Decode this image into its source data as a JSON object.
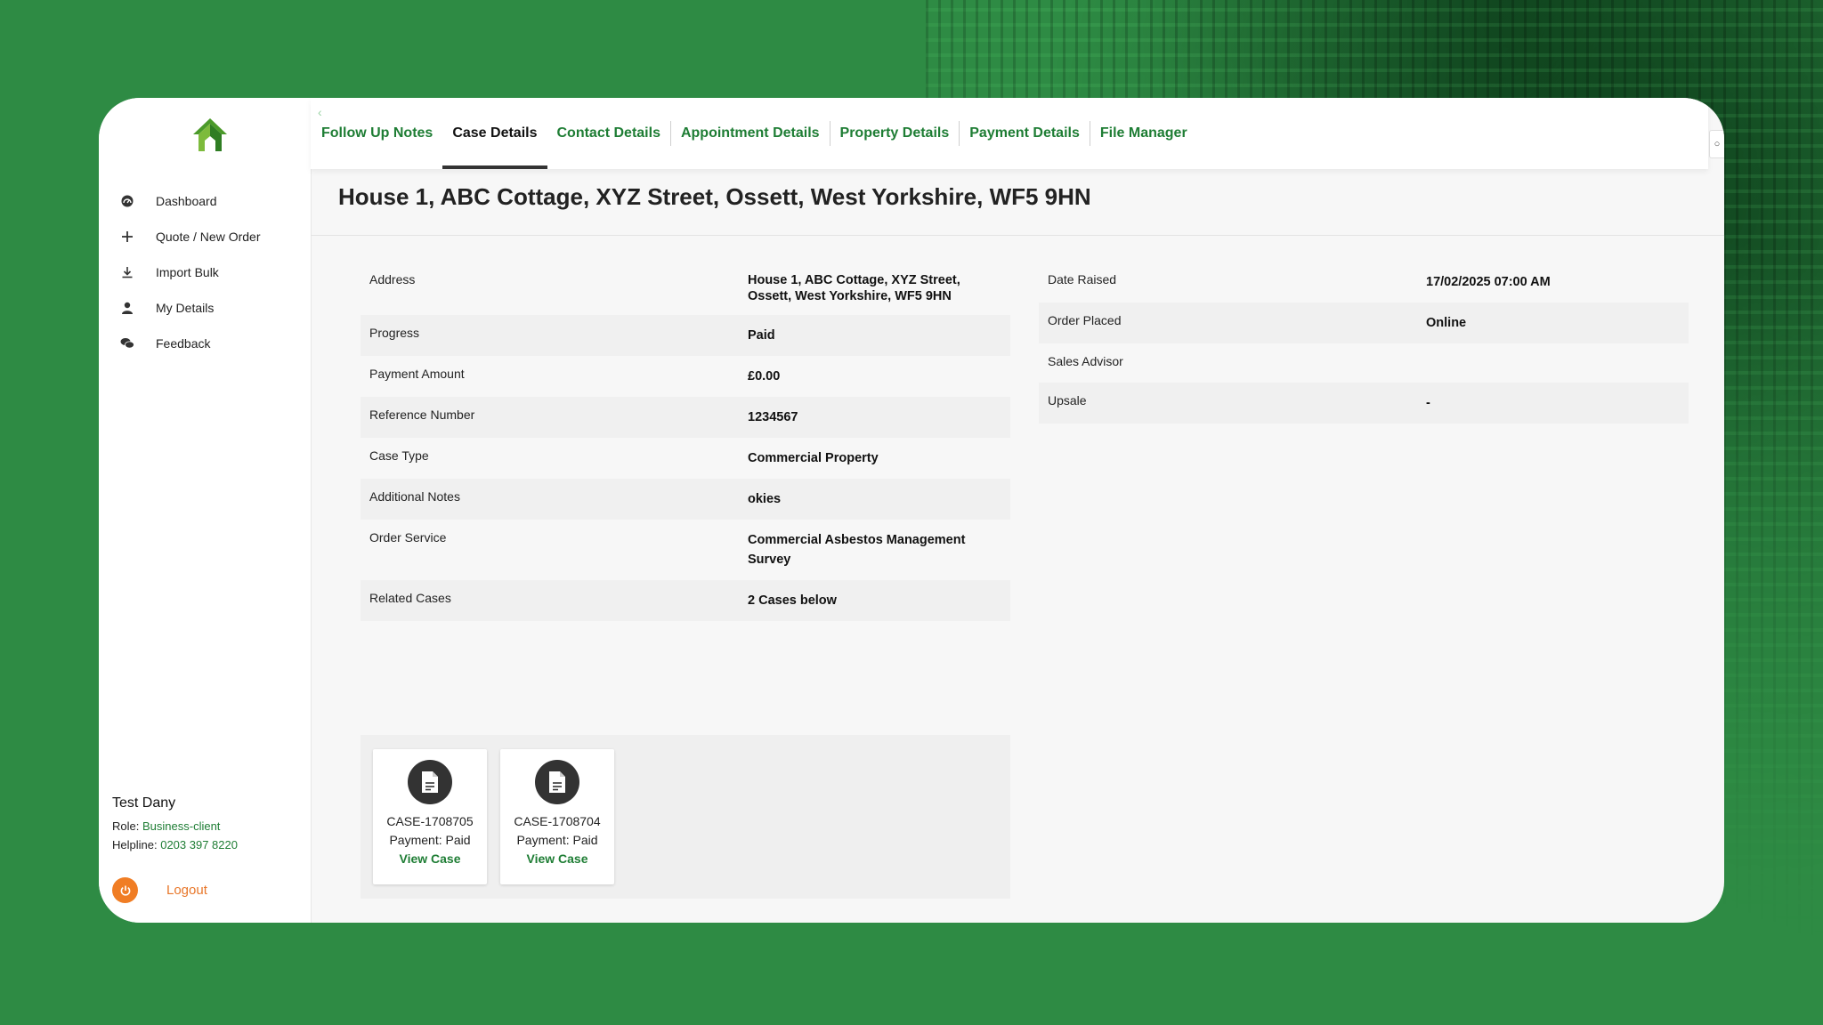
{
  "sidebar": {
    "items": [
      {
        "label": "Dashboard",
        "icon": "dashboard-icon"
      },
      {
        "label": "Quote / New Order",
        "icon": "plus-icon"
      },
      {
        "label": "Import Bulk",
        "icon": "download-icon"
      },
      {
        "label": "My Details",
        "icon": "user-icon"
      },
      {
        "label": "Feedback",
        "icon": "chat-icon"
      }
    ],
    "user": {
      "name": "Test Dany",
      "role_label": "Role:",
      "role": "Business-client",
      "helpline_label": "Helpline:",
      "helpline": "0203 397 8220"
    },
    "logout_label": "Logout"
  },
  "tabs": [
    {
      "label": "Follow Up Notes",
      "active": false
    },
    {
      "label": "Case Details",
      "active": true
    },
    {
      "label": "Contact Details",
      "active": false
    },
    {
      "label": "Appointment Details",
      "active": false
    },
    {
      "label": "Property Details",
      "active": false
    },
    {
      "label": "Payment Details",
      "active": false
    },
    {
      "label": "File Manager",
      "active": false
    }
  ],
  "page_title": "House 1, ABC Cottage, XYZ Street, Ossett, West Yorkshire, WF5 9HN",
  "details": [
    {
      "key": "Address",
      "value": "House 1, ABC Cottage, XYZ Street, Ossett, West Yorkshire, WF5 9HN"
    },
    {
      "key": "Progress",
      "value": "Paid"
    },
    {
      "key": "Payment Amount",
      "value": "£0.00"
    },
    {
      "key": "Reference Number",
      "value": "1234567"
    },
    {
      "key": "Case Type",
      "value": "Commercial Property"
    },
    {
      "key": "Additional Notes",
      "value": "okies"
    },
    {
      "key": "Order Service",
      "value": "Commercial Asbestos Management Survey"
    },
    {
      "key": "Related Cases",
      "value": "2 Cases below"
    }
  ],
  "side_details": [
    {
      "key": "Date Raised",
      "value": "17/02/2025 07:00 AM"
    },
    {
      "key": "Order Placed",
      "value": "Online"
    },
    {
      "key": "Sales Advisor",
      "value": ""
    },
    {
      "key": "Upsale",
      "value": "-"
    }
  ],
  "related_cases": [
    {
      "id": "CASE-1708705",
      "payment": "Payment: Paid",
      "link": "View Case"
    },
    {
      "id": "CASE-1708704",
      "payment": "Payment: Paid",
      "link": "View Case"
    }
  ],
  "colors": {
    "brand_green": "#1e7d34",
    "background_green": "#2e8b44",
    "logout_orange": "#f07d24"
  }
}
